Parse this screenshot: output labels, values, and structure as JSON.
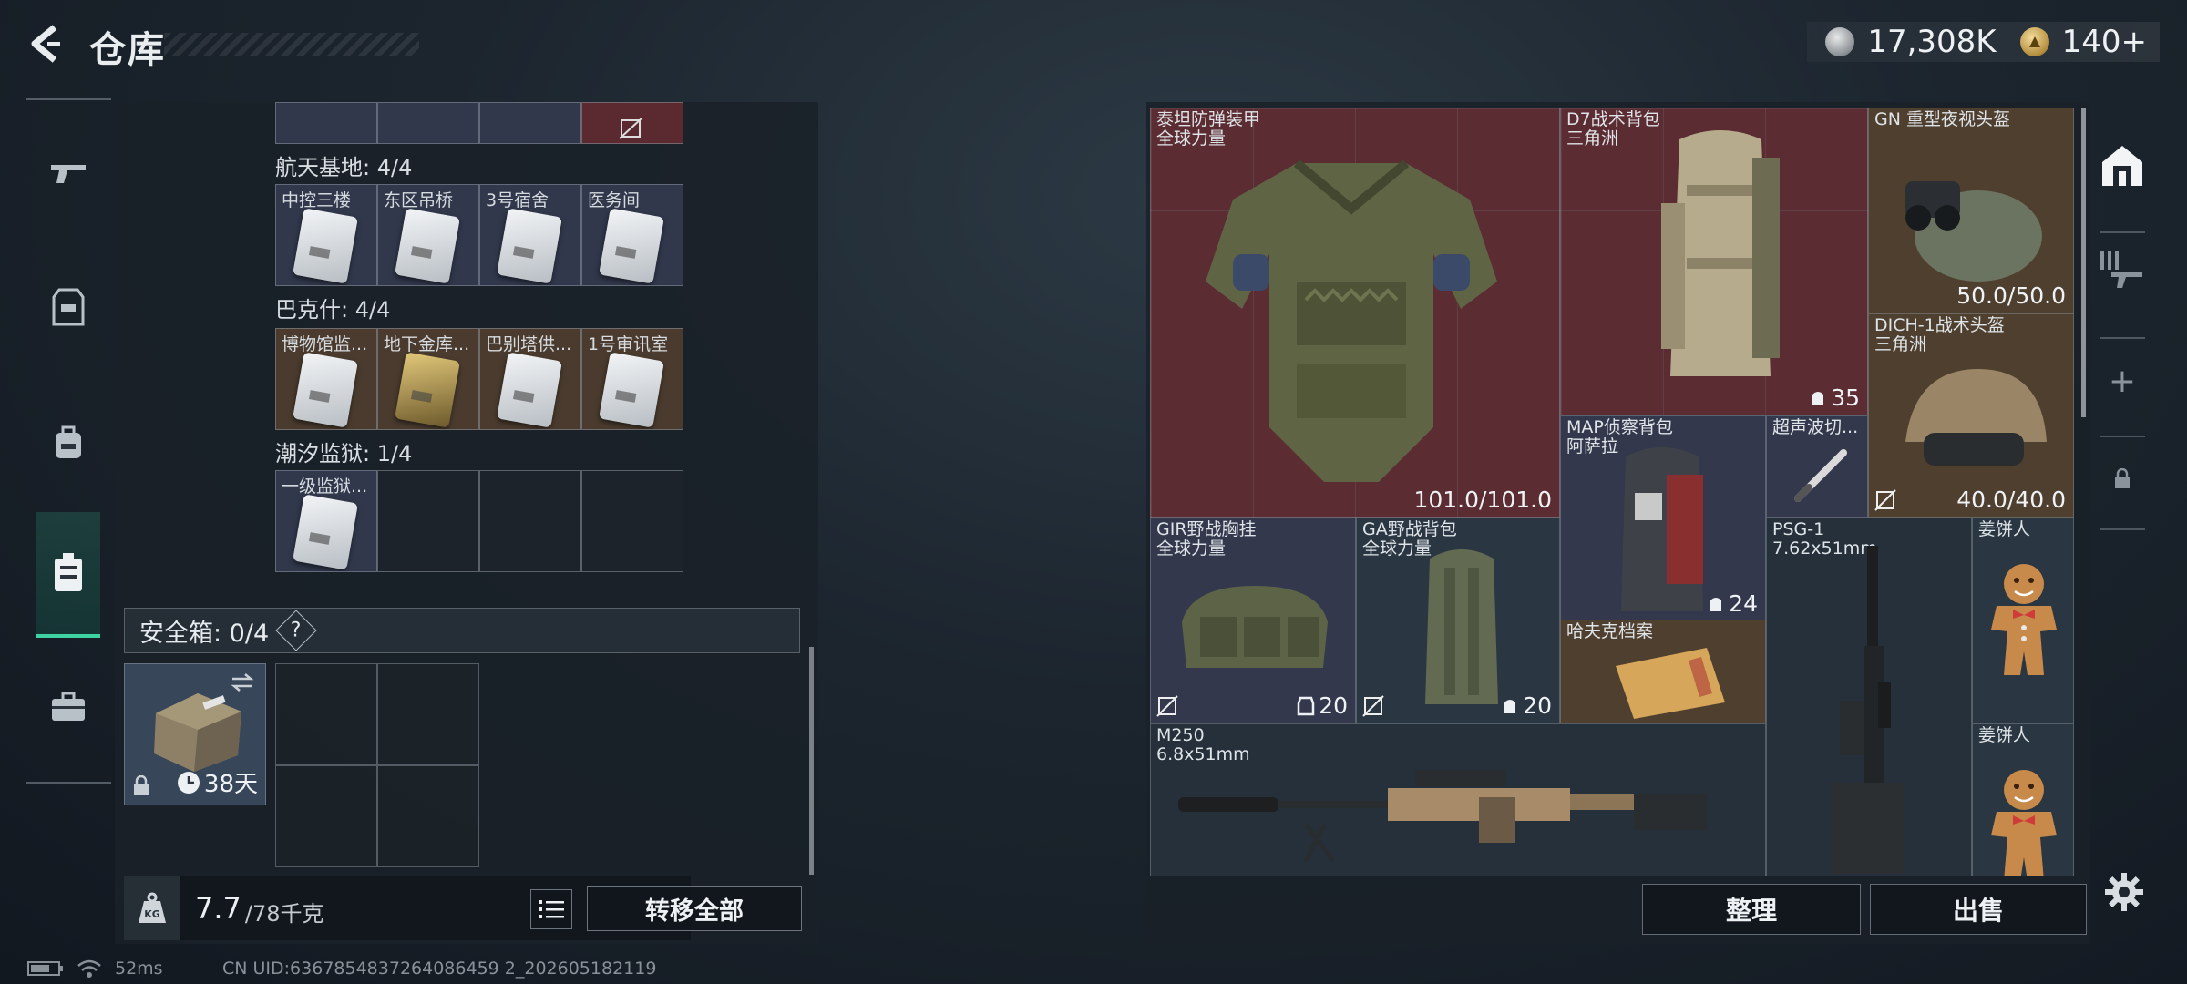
{
  "header": {
    "back_icon": "chevron-left-icon",
    "title": "仓库",
    "currency": [
      {
        "icon": "silver-coin-icon",
        "value": "17,308K"
      },
      {
        "icon": "gold-coin-icon",
        "value": "140+"
      }
    ]
  },
  "left_nav": {
    "items": [
      {
        "icon": "weapon-icon"
      },
      {
        "icon": "armor-vest-icon"
      },
      {
        "icon": "backpack-icon"
      },
      {
        "icon": "locker-icon",
        "active": true
      },
      {
        "icon": "toolbox-icon"
      }
    ]
  },
  "stash": {
    "groups": [
      {
        "title": "航天基地: 4/4",
        "cards": [
          "中控三楼",
          "东区吊桥",
          "3号宿舍",
          "医务间"
        ]
      },
      {
        "title": "巴克什: 4/4",
        "cards": [
          "博物馆监...",
          "地下金库...",
          "巴别塔供...",
          "1号审讯室"
        ]
      },
      {
        "title": "潮汐监狱: 1/4",
        "cards": [
          "一级监狱..."
        ]
      }
    ],
    "safe": {
      "title": "安全箱: 0/4",
      "help": "?",
      "duration": "38天"
    },
    "weight": {
      "current": "7.7",
      "capacity": "/78千克"
    },
    "transfer_all": "转移全部"
  },
  "inventory": {
    "items": [
      {
        "id": "armor",
        "name": "泰坦防弹装甲",
        "sub": "全球力量",
        "value": "101.0/101.0"
      },
      {
        "id": "d7",
        "name": "D7战术背包",
        "sub": "三角洲",
        "count": "35"
      },
      {
        "id": "gn",
        "name": "GN 重型夜视头盔",
        "sub": "",
        "value": "50.0/50.0"
      },
      {
        "id": "dich",
        "name": "DICH-1战术头盔",
        "sub": "三角洲",
        "value": "40.0/40.0"
      },
      {
        "id": "map",
        "name": "MAP侦察背包",
        "sub": "阿萨拉",
        "count": "24"
      },
      {
        "id": "ultra",
        "name": "超声波切...",
        "sub": ""
      },
      {
        "id": "gir",
        "name": "GIR野战胸挂",
        "sub": "全球力量",
        "count": "20"
      },
      {
        "id": "ga",
        "name": "GA野战背包",
        "sub": "全球力量",
        "count": "20"
      },
      {
        "id": "psg",
        "name": "PSG-1",
        "sub": "7.62x51mm"
      },
      {
        "id": "ginger1",
        "name": "姜饼人",
        "sub": ""
      },
      {
        "id": "hafuke",
        "name": "哈夫克档案",
        "sub": ""
      },
      {
        "id": "m250",
        "name": "M250",
        "sub": "6.8x51mm"
      },
      {
        "id": "ginger2",
        "name": "姜饼人",
        "sub": ""
      }
    ],
    "sort_label": "整理",
    "sell_label": "出售"
  },
  "right_rail": {
    "items": [
      {
        "icon": "home-base-icon"
      },
      {
        "icon": "weapon-rack-icon"
      },
      {
        "icon": "plus-icon",
        "label": "+"
      },
      {
        "icon": "lock-icon"
      }
    ],
    "settings_icon": "gear-icon"
  },
  "status_bar": {
    "ping": "52ms",
    "uid": "CN UID:6367854837264086459 2_202605182119"
  }
}
